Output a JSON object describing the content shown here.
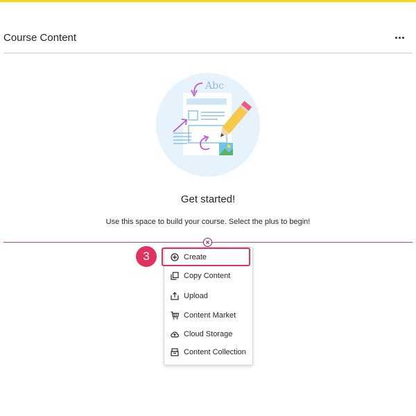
{
  "page": {
    "title": "Course Content",
    "more_icon": "more-horizontal-icon"
  },
  "empty_state": {
    "heading": "Get started!",
    "description": "Use this space to build your course. Select the plus to begin!",
    "illustration_text": "Abc"
  },
  "step_badge": "3",
  "menu": {
    "items": [
      {
        "label": "Create",
        "icon": "plus-circle-icon"
      },
      {
        "label": "Copy Content",
        "icon": "copy-icon"
      },
      {
        "label": "Upload",
        "icon": "upload-icon"
      },
      {
        "label": "Content Market",
        "icon": "cart-icon"
      },
      {
        "label": "Cloud Storage",
        "icon": "cloud-icon"
      },
      {
        "label": "Content Collection",
        "icon": "collection-icon"
      }
    ]
  },
  "colors": {
    "top_bar": "#f5d90a",
    "accent": "#8a1a7a",
    "divider": "#c0408a",
    "highlight": "#e0315f"
  }
}
